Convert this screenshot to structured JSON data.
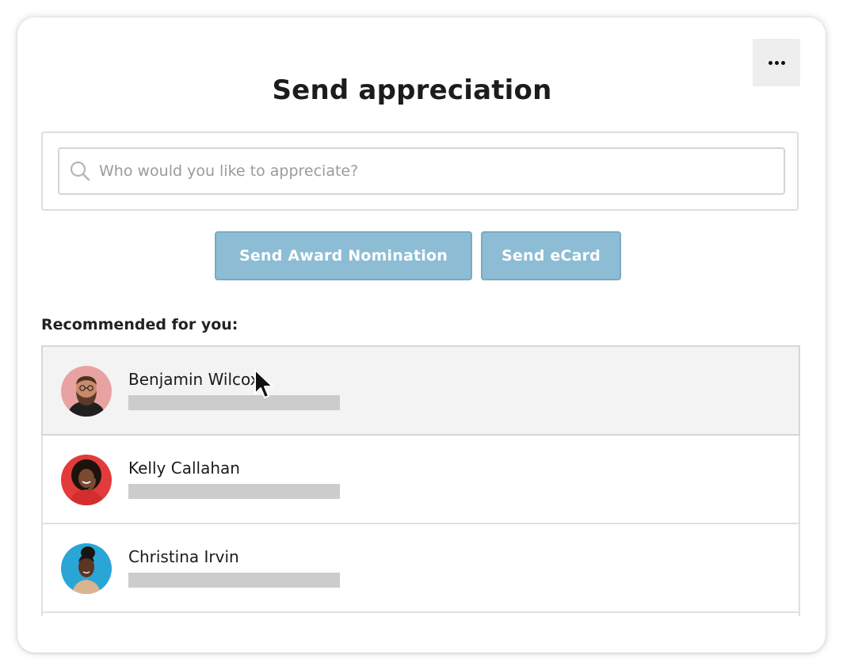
{
  "dialog": {
    "title": "Send appreciation",
    "more_icon": "more-horizontal-icon"
  },
  "search": {
    "placeholder": "Who would you like to appreciate?",
    "value": "",
    "icon": "search-icon"
  },
  "actions": {
    "award_label": "Send Award Nomination",
    "ecard_label": "Send eCard",
    "button_color": "#8dbdd4"
  },
  "recommended": {
    "label": "Recommended for you:",
    "people": [
      {
        "name": "Benjamin Wilcox",
        "avatar_bg": "#e8a2a2",
        "hovered": true
      },
      {
        "name": "Kelly Callahan",
        "avatar_bg": "#e23b3b",
        "hovered": false
      },
      {
        "name": "Christina Irvin",
        "avatar_bg": "#2aa6d6",
        "hovered": false
      }
    ]
  },
  "cursor": {
    "icon": "mouse-pointer-icon"
  }
}
